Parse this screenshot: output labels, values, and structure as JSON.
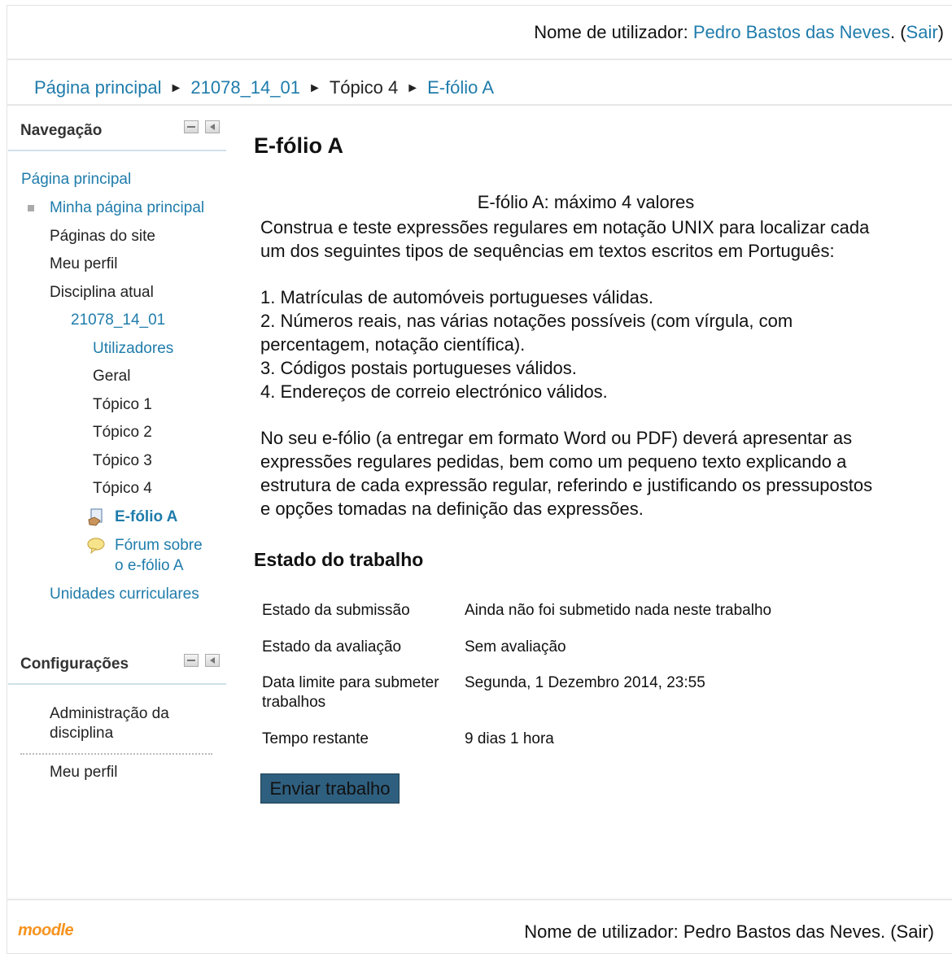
{
  "header": {
    "login_prefix": "Nome de utilizador: ",
    "user_name": "Pedro Bastos das Neves",
    "after_name": ". (",
    "logout": "Sair",
    "close_paren": ")"
  },
  "breadcrumb": {
    "items": [
      "Página principal",
      "21078_14_01",
      "Tópico 4",
      "E-fólio A"
    ],
    "separator": "►"
  },
  "navigation": {
    "title": "Navegação",
    "home": "Página principal",
    "my_home": "Minha página principal",
    "site_pages": "Páginas do site",
    "my_profile": "Meu perfil",
    "current_course": "Disciplina atual",
    "course_code": "21078_14_01",
    "participants": "Utilizadores",
    "general": "Geral",
    "topic1": "Tópico 1",
    "topic2": "Tópico 2",
    "topic3": "Tópico 3",
    "topic4": "Tópico 4",
    "efolio": "E-fólio A",
    "forum_line1": "Fórum sobre",
    "forum_line2": "o e-fólio A",
    "courses": "Unidades curriculares"
  },
  "settings": {
    "title": "Configurações",
    "course_admin_line1": "Administração da",
    "course_admin_line2": "disciplina",
    "my_profile": "Meu perfil"
  },
  "main": {
    "title": "E-fólio A",
    "intro_center": "E-fólio A: máximo 4 valores",
    "intro_p1_l1": "Construa e teste expressões regulares em notação UNIX para localizar cada",
    "intro_p1_l2": "um dos seguintes tipos de sequências em textos escritos em Português:",
    "item1": "1. Matrículas de automóveis portugueses válidas.",
    "item2_l1": "2. Números reais, nas várias notações possíveis (com vírgula, com",
    "item2_l2": "percentagem, notação científica).",
    "item3": "3. Códigos postais portugueses válidos.",
    "item4": "4. Endereços de correio electrónico válidos.",
    "p2_l1": "No seu e-fólio (a entregar em formato Word ou PDF) deverá apresentar as",
    "p2_l2": "expressões regulares pedidas, bem como um pequeno texto explicando a",
    "p2_l3": "estrutura de cada expressão regular, referindo e justificando os pressupostos",
    "p2_l4": "e opções tomadas na definição das expressões.",
    "status_heading": "Estado do trabalho",
    "rows": [
      {
        "label": "Estado da submissão",
        "value": "Ainda não foi submetido nada neste trabalho"
      },
      {
        "label": "Estado da avaliação",
        "value": "Sem avaliação"
      },
      {
        "label": "Data limite para submeter trabalhos",
        "value": "Segunda, 1 Dezembro 2014, 23:55"
      },
      {
        "label": "Tempo restante",
        "value": "9 dias 1 hora"
      }
    ],
    "submit_label": "Enviar trabalho"
  },
  "footer": {
    "logo": "moodle",
    "login_text": "Nome de utilizador: Pedro Bastos das Neves. (Sair)"
  },
  "colors": {
    "link": "#1f7cab",
    "button_bg": "#2f5f7f",
    "moodle_orange": "#f7931e"
  }
}
